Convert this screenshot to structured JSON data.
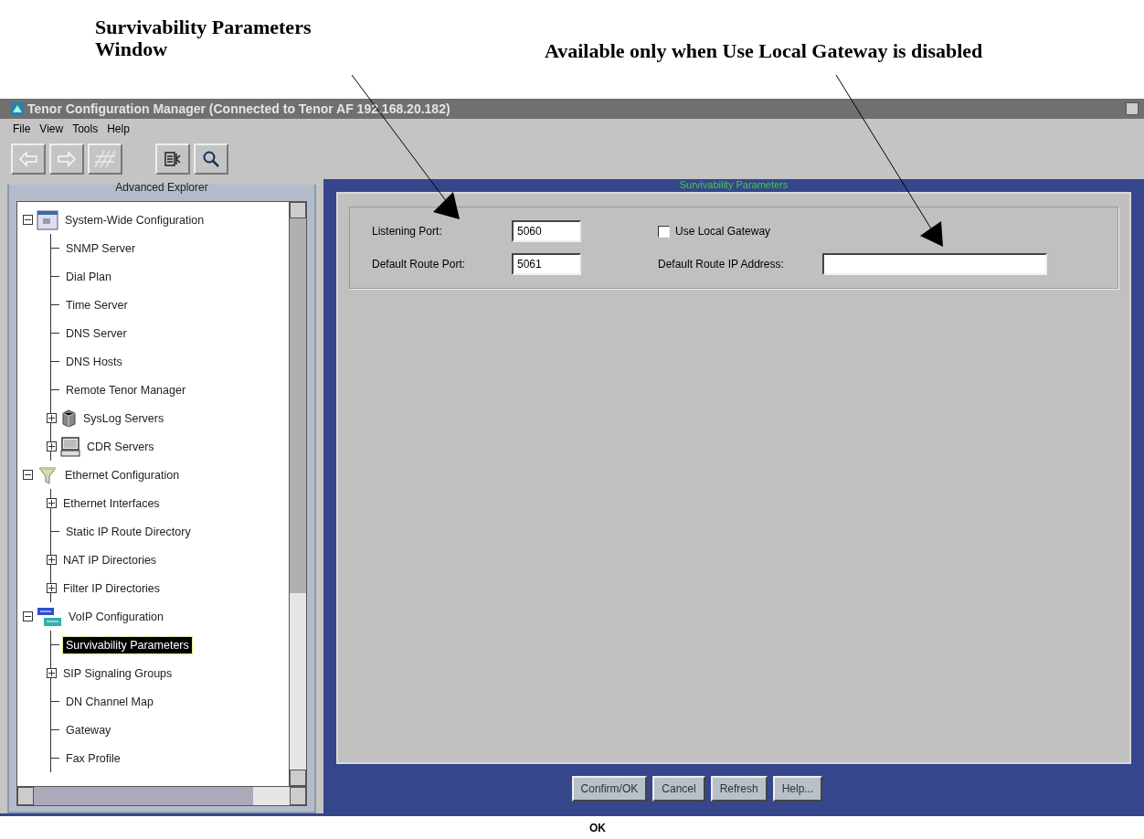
{
  "annotations": [
    {
      "text": "Survivability Parameters Window"
    },
    {
      "text": "Available only when Use Local Gateway is disabled"
    }
  ],
  "window": {
    "title": "Tenor Configuration Manager (Connected to Tenor AF 192.168.20.182)"
  },
  "menu": [
    "File",
    "View",
    "Tools",
    "Help"
  ],
  "explorer": {
    "title": "Advanced Explorer",
    "items": [
      {
        "label": "System-Wide Configuration",
        "expanded": true,
        "selected": false,
        "children": [
          {
            "label": "SNMP Server",
            "selected": false
          },
          {
            "label": "Dial Plan",
            "selected": false
          },
          {
            "label": "Time Server",
            "selected": false
          },
          {
            "label": "DNS Server",
            "selected": false
          },
          {
            "label": "DNS Hosts",
            "selected": false
          },
          {
            "label": "Remote Tenor Manager",
            "selected": false
          },
          {
            "label": "SysLog Servers",
            "expanded": false,
            "selected": false
          },
          {
            "label": "CDR Servers",
            "expanded": false,
            "selected": false
          }
        ]
      },
      {
        "label": "Ethernet Configuration",
        "expanded": true,
        "selected": false,
        "children": [
          {
            "label": "Ethernet Interfaces",
            "expanded": false,
            "selected": false
          },
          {
            "label": "Static IP Route Directory",
            "selected": false
          },
          {
            "label": "NAT IP Directories",
            "expanded": false,
            "selected": false
          },
          {
            "label": "Filter IP Directories",
            "expanded": false,
            "selected": false
          }
        ]
      },
      {
        "label": "VoIP Configuration",
        "expanded": true,
        "selected": false,
        "children": [
          {
            "label": "Survivability Parameters",
            "selected": true
          },
          {
            "label": "SIP Signaling Groups",
            "expanded": false,
            "selected": false
          },
          {
            "label": "DN Channel Map",
            "selected": false
          },
          {
            "label": "Gateway",
            "selected": false
          },
          {
            "label": "Fax Profile",
            "selected": false
          }
        ]
      }
    ]
  },
  "panel": {
    "title": "Survivability Parameters",
    "listening_port": {
      "label": "Listening Port:",
      "value": "5060"
    },
    "default_route_port": {
      "label": "Default  Route Port:",
      "value": "5061"
    },
    "use_local_gateway": {
      "label": "Use Local Gateway",
      "checked": false
    },
    "default_route_ip": {
      "label": "Default Route IP Address:"
    }
  },
  "buttons": [
    "Confirm/OK",
    "Cancel",
    "Refresh",
    "Help..."
  ],
  "status_bar": "OK"
}
